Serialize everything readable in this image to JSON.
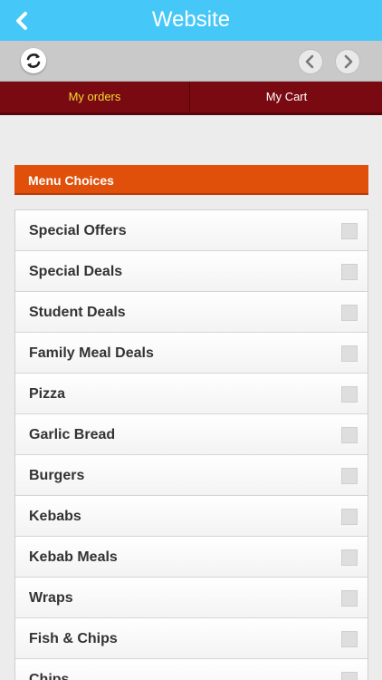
{
  "header": {
    "title": "Website",
    "back_icon": "chevron-left-icon"
  },
  "toolbar": {
    "reload_icon": "reload-icon",
    "prev_icon": "chevron-left-icon",
    "next_icon": "chevron-right-icon"
  },
  "tabs": [
    {
      "label": "My orders",
      "active": true
    },
    {
      "label": "My Cart",
      "active": false
    }
  ],
  "menu": {
    "header": "Menu Choices",
    "items": [
      {
        "label": "Special Offers"
      },
      {
        "label": "Special Deals"
      },
      {
        "label": "Student Deals"
      },
      {
        "label": "Family Meal Deals"
      },
      {
        "label": "Pizza"
      },
      {
        "label": "Garlic Bread"
      },
      {
        "label": "Burgers"
      },
      {
        "label": "Kebabs"
      },
      {
        "label": "Kebab Meals"
      },
      {
        "label": "Wraps"
      },
      {
        "label": "Fish & Chips"
      },
      {
        "label": "Chips"
      }
    ]
  },
  "colors": {
    "topbar": "#45c8f8",
    "tabs_bg": "#7a0a12",
    "active_tab_text": "#f3dc2d",
    "menu_header": "#e0500b"
  }
}
